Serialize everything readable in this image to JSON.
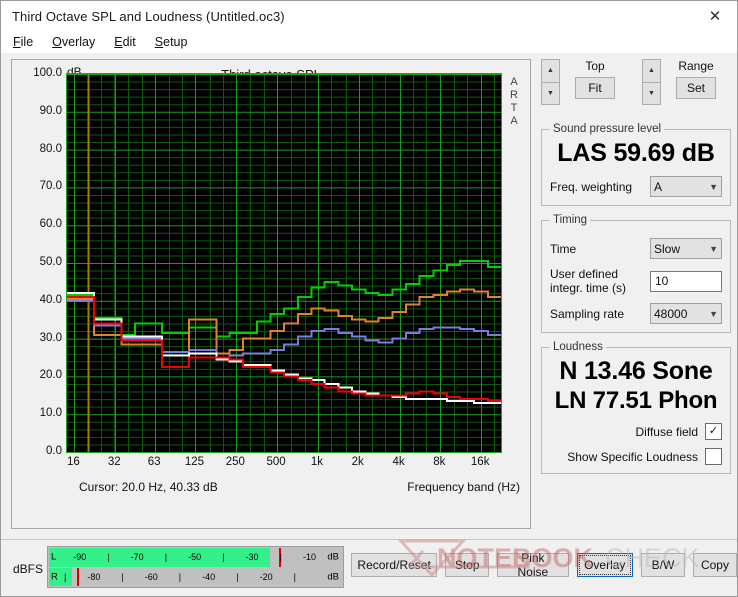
{
  "window": {
    "title": "Third Octave SPL and Loudness (Untitled.oc3)",
    "close_label": "✕"
  },
  "menu": {
    "items": [
      {
        "accel": "F",
        "rest": "ile"
      },
      {
        "accel": "O",
        "rest": "verlay"
      },
      {
        "accel": "E",
        "rest": "dit"
      },
      {
        "accel": "S",
        "rest": "etup"
      }
    ]
  },
  "graph": {
    "title": "Third octave SPL",
    "y_unit": "dB",
    "watermark_brand": "ARTA",
    "cursor_text": "Cursor:   20.0 Hz, 40.33 dB",
    "x_axis_label": "Frequency band (Hz)"
  },
  "controls": {
    "top": {
      "label": "Top",
      "button": "Fit"
    },
    "range": {
      "label": "Range",
      "button": "Set"
    },
    "spl": {
      "legend": "Sound pressure level",
      "value": "LAS 59.69 dB",
      "weighting_label": "Freq. weighting",
      "weighting_value": "A"
    },
    "timing": {
      "legend": "Timing",
      "time_label": "Time",
      "time_value": "Slow",
      "integr_label": "User defined integr. time (s)",
      "integr_value": "10",
      "sampling_label": "Sampling rate",
      "sampling_value": "48000"
    },
    "loudness": {
      "legend": "Loudness",
      "sone": "N 13.46 Sone",
      "phon": "LN 77.51 Phon",
      "diffuse_label": "Diffuse field",
      "diffuse_checked": "✓",
      "specific_label": "Show Specific Loudness",
      "specific_checked": ""
    }
  },
  "bottom": {
    "dbfs_label": "dBFS",
    "meter_left": {
      "channel": "L",
      "unit": "dB",
      "fill_pct": 75.5,
      "peak_pct": 78.5,
      "ticks": [
        "-90",
        "|",
        "-70",
        "|",
        "-50",
        "|",
        "-30",
        "|",
        "-10"
      ]
    },
    "meter_right": {
      "channel": "R",
      "unit": "dB",
      "fill_pct": 8.0,
      "peak_pct": 9.5,
      "ticks": [
        "|",
        "-80",
        "|",
        "-60",
        "|",
        "-40",
        "|",
        "-20",
        "|"
      ]
    },
    "buttons": [
      {
        "label": "Record/Reset",
        "focus": false
      },
      {
        "label": "Stop",
        "focus": false
      },
      {
        "label": "Pink Noise",
        "focus": false
      },
      {
        "label": "Overlay",
        "focus": true
      },
      {
        "label": "B/W",
        "focus": false
      },
      {
        "label": "Copy",
        "focus": false
      }
    ]
  },
  "colors": {
    "plot_bg": "#000000",
    "grid_major": "#18a018",
    "grid_minor": "#0d5a0d",
    "cursor_line": "#a08000",
    "series_green": "#00d000",
    "series_orange": "#e08030",
    "series_blue": "#7a7ae0",
    "series_white": "#ffffff",
    "series_red": "#f00000",
    "meter_fill": "#33f08a",
    "meter_peak": "#e00000"
  },
  "chart_data": {
    "type": "line",
    "title": "Third octave SPL",
    "xlabel": "Frequency band (Hz)",
    "ylabel": "dB",
    "ylim": [
      0.0,
      100.0
    ],
    "ytick_values": [
      0.0,
      10.0,
      20.0,
      30.0,
      40.0,
      50.0,
      60.0,
      70.0,
      80.0,
      90.0,
      100.0
    ],
    "ytick_labels": [
      "0.0",
      "10.0",
      "20.0",
      "30.0",
      "40.0",
      "50.0",
      "60.0",
      "70.0",
      "80.0",
      "90.0",
      "100.0"
    ],
    "xtick_labels": [
      "16",
      "32",
      "63",
      "125",
      "250",
      "500",
      "1k",
      "2k",
      "4k",
      "8k",
      "16k"
    ],
    "xtick_values": [
      16,
      32,
      63,
      125,
      250,
      500,
      1000,
      2000,
      4000,
      8000,
      16000
    ],
    "grid": true,
    "legend": "none",
    "x_bands": [
      16,
      20,
      25,
      31.5,
      40,
      50,
      63,
      80,
      100,
      125,
      160,
      200,
      250,
      315,
      400,
      500,
      630,
      800,
      1000,
      1250,
      1600,
      2000,
      2500,
      3150,
      4000,
      5000,
      6300,
      8000,
      10000,
      12500,
      16000,
      20000
    ],
    "series": [
      {
        "name": "green",
        "color": "#00d000",
        "values": [
          41.5,
          41.5,
          35.5,
          35.5,
          31.0,
          34.0,
          34.0,
          31.5,
          31.5,
          33.0,
          33.0,
          30.5,
          31.5,
          31.5,
          34.5,
          36.5,
          38.0,
          41.0,
          43.5,
          45.0,
          44.0,
          43.0,
          42.0,
          41.5,
          43.0,
          44.5,
          46.5,
          48.0,
          49.5,
          50.5,
          50.5,
          49.0
        ]
      },
      {
        "name": "orange",
        "color": "#e08030",
        "values": [
          40.5,
          40.5,
          31.0,
          31.0,
          28.5,
          28.5,
          28.5,
          26.5,
          26.5,
          35.0,
          35.0,
          26.0,
          27.0,
          30.0,
          30.0,
          32.0,
          34.0,
          36.5,
          38.0,
          37.5,
          36.0,
          35.0,
          34.5,
          35.5,
          37.0,
          39.0,
          41.0,
          41.5,
          42.5,
          43.0,
          42.5,
          41.0
        ]
      },
      {
        "name": "blue",
        "color": "#7a7ae0",
        "values": [
          40.0,
          40.0,
          33.5,
          33.5,
          30.0,
          30.0,
          30.0,
          26.5,
          26.5,
          27.0,
          27.0,
          25.0,
          25.5,
          26.0,
          26.0,
          27.0,
          28.5,
          30.5,
          32.0,
          32.5,
          31.5,
          30.5,
          29.5,
          29.0,
          30.0,
          31.5,
          32.5,
          33.0,
          33.0,
          32.5,
          32.0,
          31.0
        ]
      },
      {
        "name": "white",
        "color": "#ffffff",
        "values": [
          42.0,
          42.0,
          35.0,
          35.0,
          30.5,
          30.5,
          30.5,
          25.5,
          25.5,
          26.0,
          26.0,
          24.5,
          24.0,
          23.0,
          23.0,
          21.5,
          20.5,
          19.5,
          19.0,
          18.0,
          17.0,
          16.0,
          15.5,
          15.0,
          14.5,
          14.0,
          14.0,
          14.0,
          13.5,
          13.5,
          13.0,
          13.0
        ]
      },
      {
        "name": "red",
        "color": "#f00000",
        "values": [
          41.0,
          41.0,
          34.0,
          34.0,
          29.5,
          29.5,
          29.5,
          22.5,
          22.5,
          25.0,
          25.0,
          25.0,
          24.5,
          22.5,
          22.5,
          21.0,
          20.0,
          19.0,
          18.0,
          17.0,
          16.0,
          15.5,
          15.0,
          15.0,
          15.0,
          15.5,
          16.0,
          15.5,
          14.5,
          14.0,
          14.0,
          13.5
        ]
      }
    ],
    "cursor_line_x": 20,
    "cursor_readout": {
      "freq_hz": 20.0,
      "level_db": 40.33
    }
  }
}
